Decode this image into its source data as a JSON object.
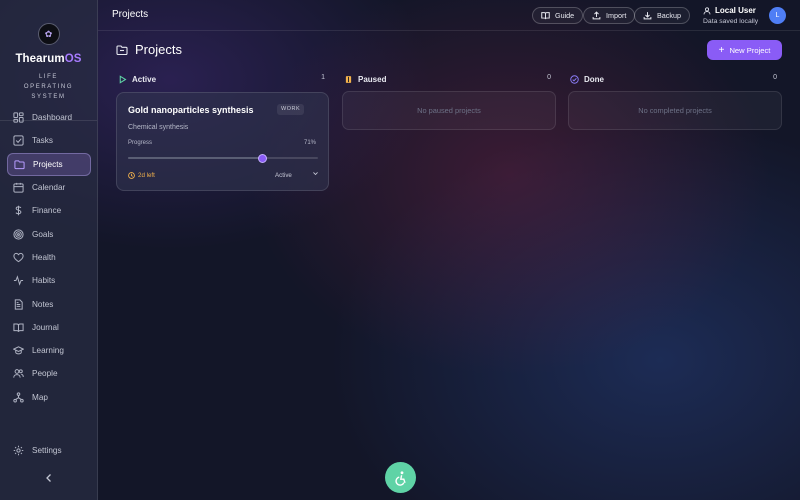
{
  "brand": {
    "name_main": "Thearum",
    "name_accent": "OS",
    "tagline": "LIFE OPERATING SYSTEM",
    "logo_text": "✿"
  },
  "sidebar": {
    "items": [
      {
        "label": "Dashboard",
        "icon": "dashboard-icon"
      },
      {
        "label": "Tasks",
        "icon": "checkbox-icon"
      },
      {
        "label": "Projects",
        "icon": "folder-icon",
        "active": true
      },
      {
        "label": "Calendar",
        "icon": "calendar-icon"
      },
      {
        "label": "Finance",
        "icon": "dollar-icon"
      },
      {
        "label": "Goals",
        "icon": "target-icon"
      },
      {
        "label": "Health",
        "icon": "heart-icon"
      },
      {
        "label": "Habits",
        "icon": "activity-icon"
      },
      {
        "label": "Notes",
        "icon": "note-icon"
      },
      {
        "label": "Journal",
        "icon": "book-icon"
      },
      {
        "label": "Learning",
        "icon": "graduation-cap-icon"
      },
      {
        "label": "People",
        "icon": "people-icon"
      },
      {
        "label": "Map",
        "icon": "map-icon"
      }
    ],
    "settings_label": "Settings"
  },
  "topbar": {
    "title": "Projects",
    "guide_label": "Guide",
    "import_label": "Import",
    "backup_label": "Backup",
    "user_name": "Local User",
    "user_status": "Data saved locally",
    "avatar_initial": "L"
  },
  "page": {
    "title": "Projects",
    "new_button_label": "New Project"
  },
  "columns": [
    {
      "label": "Active",
      "count": "1",
      "accent": "#5fd3a6"
    },
    {
      "label": "Paused",
      "count": "0",
      "accent": "#f3b24c",
      "empty_text": "No paused projects"
    },
    {
      "label": "Done",
      "count": "0",
      "accent": "#8a7cf6",
      "empty_text": "No completed projects"
    }
  ],
  "project": {
    "title": "Gold nanoparticles synthesis",
    "tag": "WORK",
    "description": "Chemical synthesis",
    "progress_label": "Progress",
    "progress_text": "71%",
    "progress": 0.71,
    "due": "2d left",
    "status": "Active"
  },
  "colors": {
    "accent": "#8a5cf6",
    "fab": "#5fd3a6",
    "warning": "#f3b24c",
    "avatar": "#4f7ef5"
  }
}
